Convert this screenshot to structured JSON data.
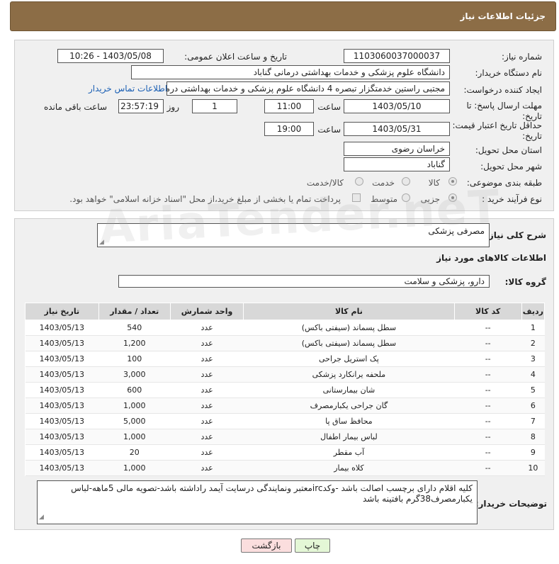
{
  "header": {
    "title": "جزئیات اطلاعات نیاز"
  },
  "form": {
    "need_number_label": "شماره نیاز:",
    "need_number": "1103060037000037",
    "announce_label": "تاریخ و ساعت اعلان عمومی:",
    "announce_value": "1403/05/08 - 10:26",
    "buyer_org_label": "نام دستگاه خریدار:",
    "buyer_org": "دانشگاه علوم پزشکی و خدمات بهداشتی درمانی گناباد",
    "requester_label": "ایجاد کننده درخواست:",
    "requester": "مجتبی راستین خدمتگزار تبصره 4 دانشگاه علوم پزشکی و خدمات بهداشتی درمانی گناباد",
    "contact_link": "اطلاعات تماس خریدار",
    "deadline_label_1": "مهلت ارسال پاسخ: تا",
    "deadline_label_2": "تاریخ:",
    "deadline_date": "1403/05/10",
    "time_label": "ساعت",
    "deadline_time": "11:00",
    "days_value": "1",
    "days_label": "روز و",
    "remaining_time": "23:57:19",
    "remaining_label": "ساعت باقی مانده",
    "validity_label_1": "حداقل تاریخ اعتبار قیمت: تا",
    "validity_label_2": "تاریخ:",
    "validity_date": "1403/05/31",
    "validity_time": "19:00",
    "province_label": "استان محل تحویل:",
    "province": "خراسان رضوی",
    "city_label": "شهر محل تحویل:",
    "city": "گناباد",
    "category_label": "طبقه بندی موضوعی:",
    "category_options": [
      "کالا",
      "خدمت",
      "کالا/خدمت"
    ],
    "process_label": "نوع فرآیند خرید :",
    "process_options": [
      "جزیی",
      "متوسط"
    ],
    "payment_note": "پرداخت تمام یا بخشی از مبلغ خرید،از محل \"اسناد خزانه اسلامی\" خواهد بود."
  },
  "description": {
    "label": "شرح کلی نیاز:",
    "value": "مصرفی پزشکی"
  },
  "goods": {
    "section_title": "اطلاعات کالاهای مورد نیاز",
    "group_label": "گروه کالا:",
    "group_value": "دارو، پزشکی و سلامت",
    "columns": [
      "ردیف",
      "کد کالا",
      "نام کالا",
      "واحد شمارش",
      "تعداد / مقدار",
      "تاریخ نیاز"
    ],
    "rows": [
      [
        "1",
        "--",
        "سطل پسماند (سیفتی باکس)",
        "عدد",
        "540",
        "1403/05/13"
      ],
      [
        "2",
        "--",
        "سطل پسماند (سیفتی باکس)",
        "عدد",
        "1,200",
        "1403/05/13"
      ],
      [
        "3",
        "--",
        "پک استریل جراحی",
        "عدد",
        "100",
        "1403/05/13"
      ],
      [
        "4",
        "--",
        "ملحفه یرانکارد پزشکی",
        "عدد",
        "3,000",
        "1403/05/13"
      ],
      [
        "5",
        "--",
        "شان بیمارستانی",
        "عدد",
        "600",
        "1403/05/13"
      ],
      [
        "6",
        "--",
        "گان جراحی یکبارمصرف",
        "عدد",
        "1,000",
        "1403/05/13"
      ],
      [
        "7",
        "--",
        "محافظ ساق پا",
        "عدد",
        "5,000",
        "1403/05/13"
      ],
      [
        "8",
        "--",
        "لباس بیمار اطفال",
        "عدد",
        "1,000",
        "1403/05/13"
      ],
      [
        "9",
        "--",
        "آب مقطر",
        "عدد",
        "20",
        "1403/05/13"
      ],
      [
        "10",
        "--",
        "کلاه بیمار",
        "عدد",
        "1,000",
        "1403/05/13"
      ]
    ]
  },
  "buyer_notes": {
    "label": "توضیحات خریدار:",
    "value": "کلیه اقلام دارای برچسب اصالت باشد -وکدircمعتبر ونمایندگی درسایت آیمد راداشته باشد-تصویه مالی 5ماهه-لباس یکبارمصرف38گرم بافتینه باشد"
  },
  "buttons": {
    "print": "چاپ",
    "back": "بازگشت"
  },
  "watermark": "AriaTender.neT"
}
